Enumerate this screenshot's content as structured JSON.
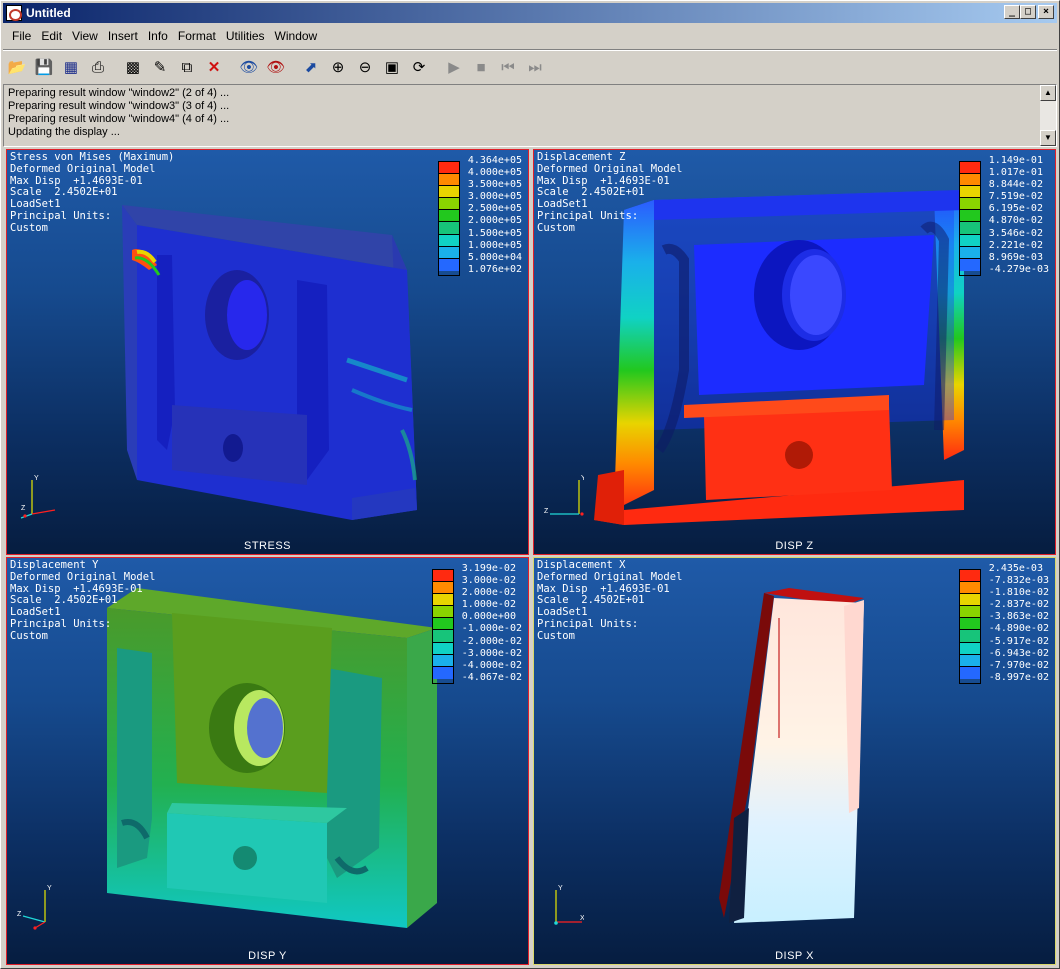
{
  "window": {
    "title": "Untitled",
    "btn_min": "_",
    "btn_max": "□",
    "btn_close": "×"
  },
  "menu": [
    "File",
    "Edit",
    "View",
    "Insert",
    "Info",
    "Format",
    "Utilities",
    "Window"
  ],
  "messages": [
    "Preparing result window \"window2\" (2 of 4) ...",
    "Preparing result window \"window3\" (3 of 4) ...",
    "Preparing result window \"window4\" (4 of 4) ...",
    "Updating the display ..."
  ],
  "common_info": {
    "deformed": "Deformed Original Model",
    "maxdisp": "Max Disp  +1.4693E-01",
    "scale": "Scale  2.4502E+01",
    "loadset": "LoadSet1",
    "principal": "Principal Units:",
    "custom": "Custom"
  },
  "viewports": [
    {
      "title": "Stress von Mises (Maximum)",
      "label": "STRESS",
      "legend": [
        "4.364e+05",
        "4.000e+05",
        "3.500e+05",
        "3.000e+05",
        "2.500e+05",
        "2.000e+05",
        "1.500e+05",
        "1.000e+05",
        "5.000e+04",
        "1.076e+02"
      ]
    },
    {
      "title": "Displacement Z",
      "label": "DISP Z",
      "legend": [
        "1.149e-01",
        "1.017e-01",
        "8.844e-02",
        "7.519e-02",
        "6.195e-02",
        "4.870e-02",
        "3.546e-02",
        "2.221e-02",
        "8.969e-03",
        "-4.279e-03"
      ]
    },
    {
      "title": "Displacement Y",
      "label": "DISP Y",
      "legend": [
        "3.199e-02",
        "3.000e-02",
        "2.000e-02",
        "1.000e-02",
        "0.000e+00",
        "-1.000e-02",
        "-2.000e-02",
        "-3.000e-02",
        "-4.000e-02",
        "-4.067e-02"
      ]
    },
    {
      "title": "Displacement X",
      "label": "DISP X",
      "legend": [
        "2.435e-03",
        "-7.832e-03",
        "-1.810e-02",
        "-2.837e-02",
        "-3.863e-02",
        "-4.890e-02",
        "-5.917e-02",
        "-6.943e-02",
        "-7.970e-02",
        "-8.997e-02"
      ]
    }
  ],
  "colors": {
    "legend_bands": [
      "#ff2a10",
      "#ff8a00",
      "#e8d400",
      "#8ad400",
      "#22c81e",
      "#17c47a",
      "#10d2c4",
      "#1ab0ea",
      "#2468ff",
      "#1a28d8"
    ],
    "active_border": "#e0202a",
    "inactive_border": "#d8d86a"
  },
  "axes": {
    "x": "X",
    "y": "Y",
    "z": "Z"
  }
}
